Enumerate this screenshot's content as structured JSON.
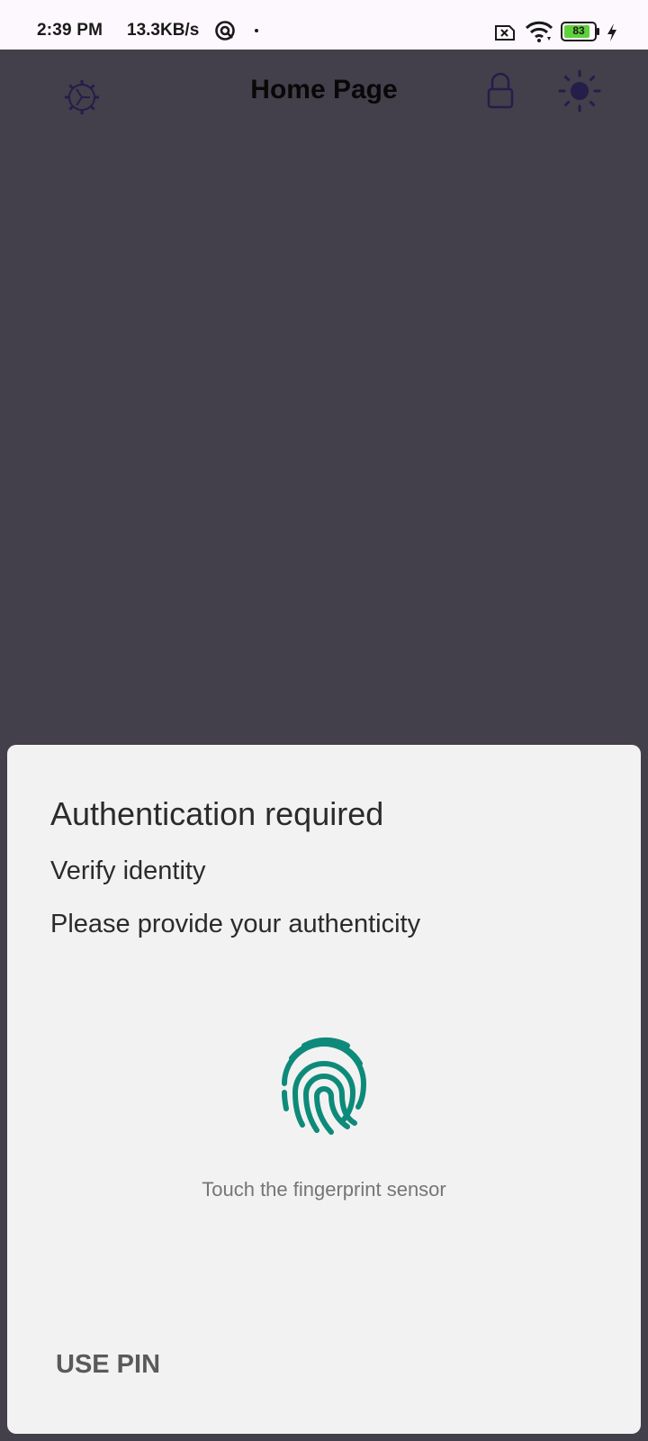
{
  "status_bar": {
    "time": "2:39 PM",
    "network_speed": "13.3KB/s",
    "battery_level": "83",
    "icons": [
      "at-sign-icon",
      "notification-dot-icon",
      "no-sim-icon",
      "wifi-icon",
      "battery-icon",
      "charging-bolt-icon"
    ]
  },
  "app_bar": {
    "title": "Home Page",
    "icons": [
      "gear-icon",
      "lock-icon",
      "sun-icon"
    ]
  },
  "auth_sheet": {
    "title": "Authentication required",
    "subtitle": "Verify identity",
    "description": "Please provide your authenticity",
    "icon": "fingerprint-icon",
    "hint": "Touch the fingerprint sensor",
    "negative_button": "USE PIN"
  },
  "colors": {
    "scrim_background": "#433f4b",
    "sheet_background": "#f2f2f2",
    "fingerprint_accent": "#0e8a7a",
    "app_icon_color": "#241e4a",
    "battery_fill": "#5fd13a"
  }
}
